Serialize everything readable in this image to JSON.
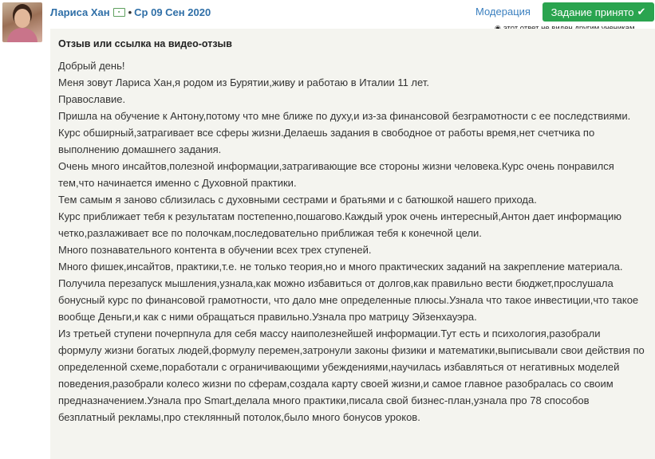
{
  "author": {
    "name": "Лариса Хан",
    "separator": "•",
    "date": "Ср 09 Сен 2020"
  },
  "icons": {
    "avatar": "user-avatar",
    "badge": "id-card-icon",
    "check": "check-icon",
    "eye": "eye-slash-icon"
  },
  "colors": {
    "accent": "#2f6fa7",
    "accepted": "#2aa44f",
    "card_bg": "#f4f4ef"
  },
  "actions": {
    "moderation": "Модерация",
    "accepted": "Задание принято"
  },
  "visibility_note": "этот ответ не виден другим ученикам",
  "card": {
    "title": "Отзыв или ссылка на видео-отзыв",
    "paragraphs": [
      "Добрый день!",
      "Меня зовут Лариса Хан,я родом из Бурятии,живу и работаю в Италии 11 лет.",
      "Православие.",
      "Пришла на обучение к Антону,потому что мне ближе по духу,и из-за финансовой безграмотности с ее последствиями.",
      "Курс обширный,затрагивает все сферы жизни.Делаешь задания в свободное от работы время,нет счетчика по выполнению домашнего задания.",
      "Очень много инсайтов,полезной информации,затрагивающие все стороны жизни человека.Курс очень понравился тем,что начинается именно с Духовной практики.",
      "Тем самым я заново сблизилась с духовными сестрами и братьями и с батюшкой нашего прихода.",
      "Курс приближает тебя к результатам постепенно,пошагово.Каждый урок очень интересный,Антон дает информацию четко,разлаживает все по полочкам,последовательно приближая тебя к конечной цели.",
      "Много познавательного контента в обучении всех трех ступеней.",
      "Много фишек,инсайтов, практики,т.е. не только теория,но и много практических заданий на закрепление материала.",
      "Получила перезапуск мышления,узнала,как можно избавиться от долгов,как правильно вести бюджет,прослушала бонусный курс по финансовой грамотности, что дало мне определенные плюсы.Узнала что такое инвестиции,что такое вообще Деньги,и как с ними обращаться правильно.Узнала про матрицу Эйзенхауэра.",
      "Из третьей ступени почерпнула для себя массу наиполезнейшей информации.Тут есть и психология,разобрали формулу жизни богатых людей,формулу перемен,затронули законы физики и математики,выписывали свои действия по определенной схеме,поработали с ограничивающими убеждениями,научилась избавляться от негативных моделей поведения,разобрали колесо жизни по сферам,создала карту своей жизни,и самое главное разобралась со своим предназначением.Узнала про Smart,делала много практики,писала свой бизнес-план,узнала про 78 способов безплатный рекламы,про стеклянный потолок,было много бонусов уроков."
    ]
  }
}
